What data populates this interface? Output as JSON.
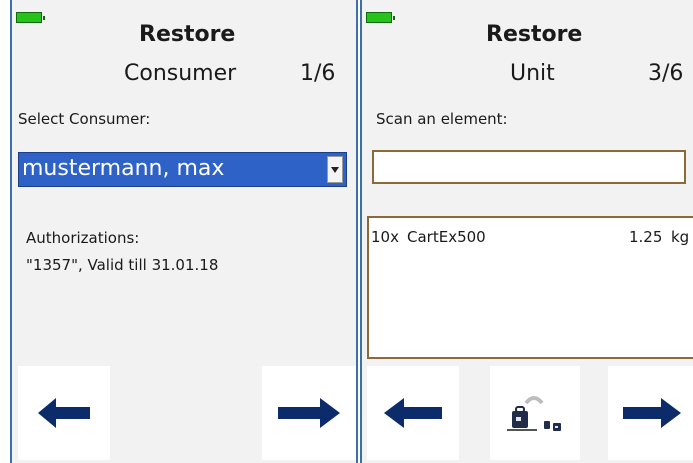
{
  "left_screen": {
    "title": "Restore",
    "subtitle": "Consumer",
    "step": "1/6",
    "select_label": "Select Consumer:",
    "selected_consumer": "mustermann, max",
    "authorizations_label": "Authorizations:",
    "authorizations_value": "\"1357\", Valid till 31.01.18",
    "back_icon": "arrow-left-icon",
    "next_icon": "arrow-right-icon"
  },
  "right_screen": {
    "title": "Restore",
    "subtitle": "Unit",
    "step": "3/6",
    "scan_label": "Scan an element:",
    "scan_value": "",
    "items": [
      {
        "qty": "10x",
        "name": "CartEx500",
        "weight": "1.25",
        "unit": "kg"
      }
    ],
    "back_icon": "arrow-left-icon",
    "middle_icon": "weighing-scale-icon",
    "next_icon": "arrow-right-icon"
  },
  "colors": {
    "panel_bg": "#f2f2f2",
    "border_blue": "#3f6fa8",
    "select_blue": "#2e62c6",
    "arrow_navy": "#0b2b6b",
    "battery_green": "#27c21a",
    "input_border": "#8b6a3a"
  }
}
